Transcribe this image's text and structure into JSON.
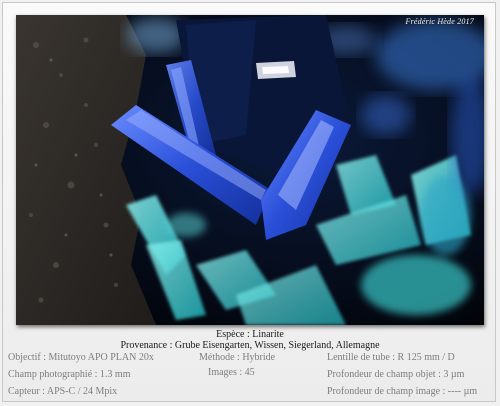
{
  "photo": {
    "signature": "Frédéric Hède 2017",
    "subject": "mineral-micrograph"
  },
  "caption": {
    "species": "Espèce : Linarite",
    "provenance": "Provenance : Grube Eisengarten, Wissen, Siegerland, Allemagne"
  },
  "info": {
    "objectif": "Objectif : Mitutoyo APO PLAN 20x",
    "champ": "Champ photographié : 1.3 mm",
    "capteur": "Capteur : APS-C / 24 Mpix",
    "methode": "Méthode : Hybride",
    "images": "Images : 45",
    "lentille": "Lentille de tube : R 125 mm / D",
    "profondeur_objet": "Profondeur de champ objet : 3 µm",
    "profondeur_image": "Profondeur de champ image : ---- µm"
  },
  "colors": {
    "background": "#f1f1f1",
    "caption_text": "#1a1a1a",
    "info_text": "#7d7d7d",
    "linarite_blue": "#2f5fe0",
    "cyan_crystals": "#46d6d4"
  }
}
